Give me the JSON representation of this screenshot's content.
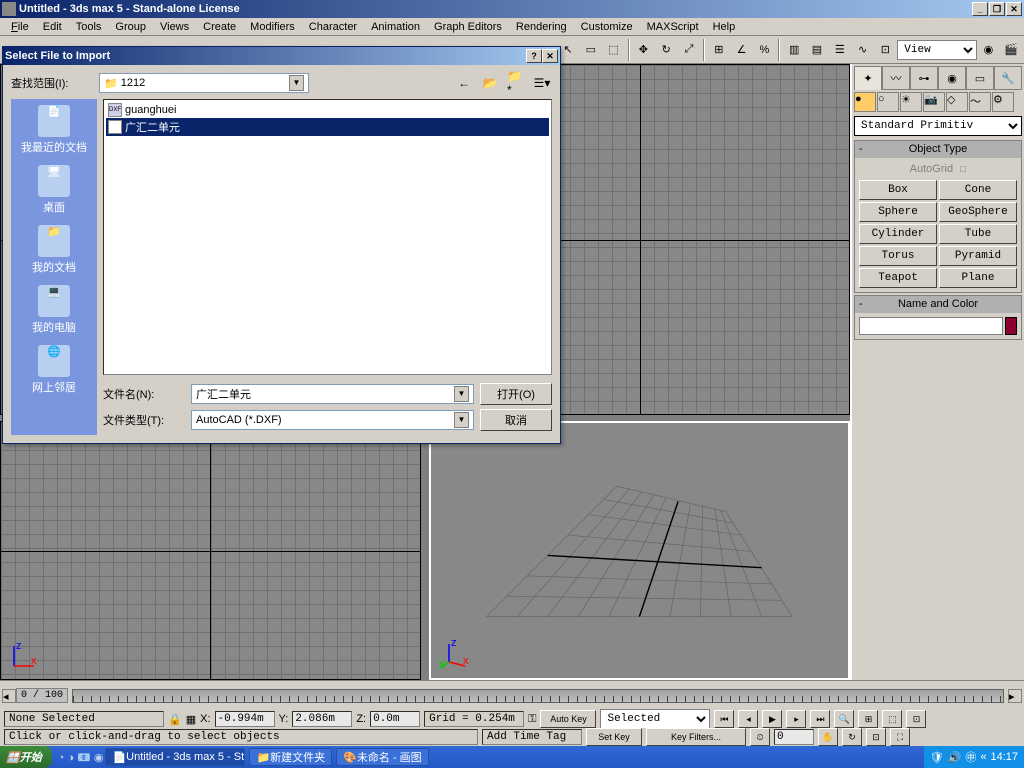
{
  "titlebar": {
    "text": "Untitled - 3ds max 5 - Stand-alone License"
  },
  "menu": {
    "file": "File",
    "edit": "Edit",
    "tools": "Tools",
    "group": "Group",
    "views": "Views",
    "create": "Create",
    "modifiers": "Modifiers",
    "character": "Character",
    "animation": "Animation",
    "graph": "Graph Editors",
    "rendering": "Rendering",
    "customize": "Customize",
    "maxscript": "MAXScript",
    "help": "Help"
  },
  "toolbar": {
    "view_selector": "View"
  },
  "cmdpanel": {
    "dropdown": "Standard Primitiv",
    "rollout_object": "Object Type",
    "autogrid": "AutoGrid",
    "btns": {
      "box": "Box",
      "cone": "Cone",
      "sphere": "Sphere",
      "geosphere": "GeoSphere",
      "cylinder": "Cylinder",
      "tube": "Tube",
      "torus": "Torus",
      "pyramid": "Pyramid",
      "teapot": "Teapot",
      "plane": "Plane"
    },
    "rollout_name": "Name and Color"
  },
  "timeline": {
    "frame": "0 / 100"
  },
  "status": {
    "sel": "None Selected",
    "x": "-0.994m",
    "y": "2.086m",
    "z": "0.0m",
    "grid": "Grid = 0.254m",
    "autokey": "Auto Key",
    "setkey": "Set Key",
    "selected": "Selected",
    "keyfilters": "Key Filters...",
    "addtag": "Add Time Tag",
    "frame0": "0",
    "prompt": "Click or click-and-drag to select objects"
  },
  "dialog": {
    "title": "Select File to Import",
    "lookin_label": "查找范围(I):",
    "lookin_value": "1212",
    "places": {
      "recent": "我最近的文档",
      "desktop": "桌面",
      "mydocs": "我的文档",
      "mycomp": "我的电脑",
      "network": "网上邻居"
    },
    "files": {
      "f1": "guanghuei",
      "f2": "广汇二单元"
    },
    "filename_label": "文件名(N):",
    "filename_value": "广汇二单元",
    "filetype_label": "文件类型(T):",
    "filetype_value": "AutoCAD (*.DXF)",
    "open_btn": "打开(O)",
    "cancel_btn": "取消"
  },
  "taskbar": {
    "start": "开始",
    "task1": "Untitled - 3ds max 5 - St...",
    "task2": "新建文件夹",
    "task3": "未命名 - 画图",
    "clock": "14:17"
  }
}
